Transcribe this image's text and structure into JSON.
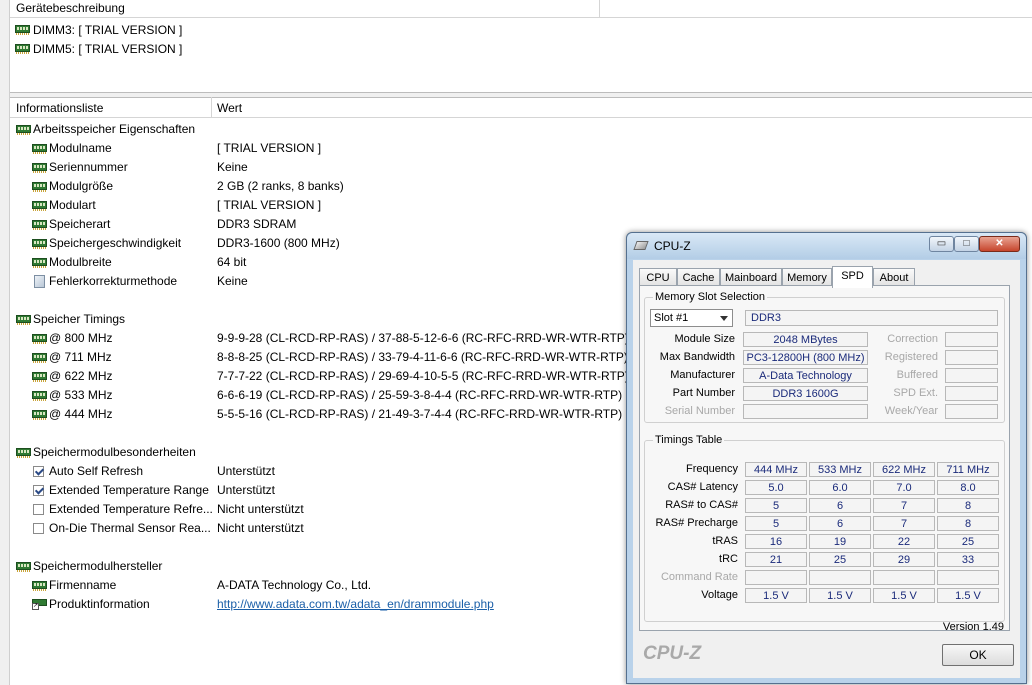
{
  "device_pane": {
    "header": "Gerätebeschreibung",
    "items": [
      "DIMM3: [ TRIAL VERSION ]",
      "DIMM5: [ TRIAL VERSION ]"
    ]
  },
  "info_pane": {
    "col_field": "Informationsliste",
    "col_value": "Wert",
    "sections": {
      "props": {
        "title": "Arbeitsspeicher Eigenschaften",
        "rows": [
          {
            "label": "Modulname",
            "value": "[ TRIAL VERSION ]"
          },
          {
            "label": "Seriennummer",
            "value": "Keine"
          },
          {
            "label": "Modulgröße",
            "value": "2 GB (2 ranks, 8 banks)"
          },
          {
            "label": "Modulart",
            "value": "[ TRIAL VERSION ]"
          },
          {
            "label": "Speicherart",
            "value": "DDR3 SDRAM"
          },
          {
            "label": "Speichergeschwindigkeit",
            "value": "DDR3-1600 (800 MHz)"
          },
          {
            "label": "Modulbreite",
            "value": "64 bit"
          },
          {
            "label": "Fehlerkorrekturmethode",
            "value": "Keine"
          }
        ]
      },
      "timings": {
        "title": "Speicher Timings",
        "rows": [
          {
            "label": "@ 800 MHz",
            "value": "9-9-9-28  (CL-RCD-RP-RAS) / 37-88-5-12-6-6  (RC-RFC-RRD-WR-WTR-RTP)"
          },
          {
            "label": "@ 711 MHz",
            "value": "8-8-8-25  (CL-RCD-RP-RAS) / 33-79-4-11-6-6  (RC-RFC-RRD-WR-WTR-RTP)"
          },
          {
            "label": "@ 622 MHz",
            "value": "7-7-7-22  (CL-RCD-RP-RAS) / 29-69-4-10-5-5  (RC-RFC-RRD-WR-WTR-RTP)"
          },
          {
            "label": "@ 533 MHz",
            "value": "6-6-6-19  (CL-RCD-RP-RAS) / 25-59-3-8-4-4  (RC-RFC-RRD-WR-WTR-RTP)"
          },
          {
            "label": "@ 444 MHz",
            "value": "5-5-5-16  (CL-RCD-RP-RAS) / 21-49-3-7-4-4  (RC-RFC-RRD-WR-WTR-RTP)"
          }
        ]
      },
      "features": {
        "title": "Speichermodulbesonderheiten",
        "rows": [
          {
            "label": "Auto Self Refresh",
            "value": "Unterstützt",
            "checked": true
          },
          {
            "label": "Extended Temperature Range",
            "value": "Unterstützt",
            "checked": true
          },
          {
            "label": "Extended Temperature Refre...",
            "value": "Nicht unterstützt",
            "checked": false
          },
          {
            "label": "On-Die Thermal Sensor Rea...",
            "value": "Nicht unterstützt",
            "checked": false
          }
        ]
      },
      "vendor": {
        "title": "Speichermodulhersteller",
        "rows": [
          {
            "label": "Firmenname",
            "value": "A-DATA Technology Co., Ltd."
          },
          {
            "label": "Produktinformation",
            "value": "http://www.adata.com.tw/adata_en/drammodule.php"
          }
        ]
      }
    }
  },
  "cpuz": {
    "title": "CPU-Z",
    "window_buttons": {
      "minimize": "▭",
      "maximize": "□",
      "close": "✕"
    },
    "tabs": [
      "CPU",
      "Cache",
      "Mainboard",
      "Memory",
      "SPD",
      "About"
    ],
    "selected_tab": "SPD",
    "slot_group": {
      "title": "Memory Slot Selection",
      "slot_selected": "Slot #1",
      "memory_type": "DDR3",
      "module_size_label": "Module Size",
      "module_size": "2048 MBytes",
      "max_bandwidth_label": "Max Bandwidth",
      "max_bandwidth": "PC3-12800H (800 MHz)",
      "manufacturer_label": "Manufacturer",
      "manufacturer": "A-Data Technology",
      "part_number_label": "Part Number",
      "part_number": "DDR3 1600G",
      "serial_number_label": "Serial Number",
      "serial_number": "",
      "correction_label": "Correction",
      "registered_label": "Registered",
      "buffered_label": "Buffered",
      "spd_ext_label": "SPD Ext.",
      "week_year_label": "Week/Year"
    },
    "timings_table": {
      "title": "Timings Table",
      "row_labels": [
        "Frequency",
        "CAS# Latency",
        "RAS# to CAS#",
        "RAS# Precharge",
        "tRAS",
        "tRC",
        "Command Rate",
        "Voltage"
      ],
      "columns": [
        [
          "444 MHz",
          "5.0",
          "5",
          "5",
          "16",
          "21",
          "",
          "1.5 V"
        ],
        [
          "533 MHz",
          "6.0",
          "6",
          "6",
          "19",
          "25",
          "",
          "1.5 V"
        ],
        [
          "622 MHz",
          "7.0",
          "7",
          "7",
          "22",
          "29",
          "",
          "1.5 V"
        ],
        [
          "711 MHz",
          "8.0",
          "8",
          "8",
          "25",
          "33",
          "",
          "1.5 V"
        ]
      ]
    },
    "version": "Version 1.49",
    "logo": "CPU-Z",
    "ok_label": "OK"
  }
}
